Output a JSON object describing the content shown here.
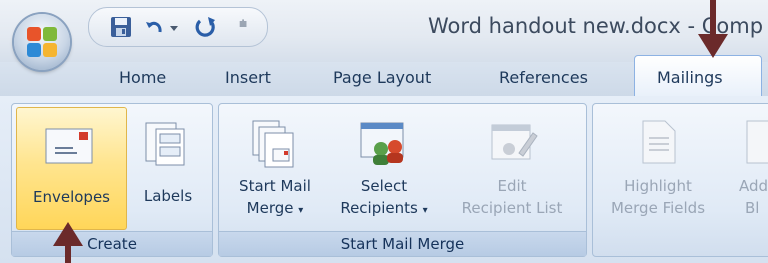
{
  "window": {
    "title": "Word handout new.docx - Comp"
  },
  "quick_access": {
    "save_icon": "save-icon",
    "undo_icon": "undo-icon",
    "redo_icon": "redo-icon",
    "customize_glyph": "⩧"
  },
  "tabs": [
    {
      "label": "Home"
    },
    {
      "label": "Insert"
    },
    {
      "label": "Page Layout"
    },
    {
      "label": "References"
    },
    {
      "label": "Mailings"
    }
  ],
  "groups": {
    "create": {
      "label": "Create",
      "envelopes": "Envelopes",
      "labels": "Labels"
    },
    "start_mail_merge": {
      "label": "Start Mail Merge",
      "start_mail_merge_line1": "Start Mail",
      "start_mail_merge_line2": "Merge",
      "select_recipients_line1": "Select",
      "select_recipients_line2": "Recipients",
      "edit_recipient_list_line1": "Edit",
      "edit_recipient_list_line2": "Recipient List"
    },
    "write_insert": {
      "highlight_line1": "Highlight",
      "highlight_line2": "Merge Fields",
      "address_line1": "Add",
      "address_line2": "Bl"
    }
  },
  "colors": {
    "accent_highlight": "#ffd659",
    "annotation_arrow": "#6b2a2a"
  }
}
